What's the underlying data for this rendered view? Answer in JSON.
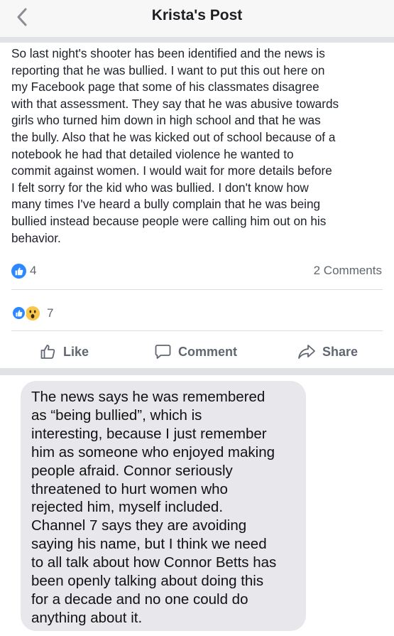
{
  "header": {
    "title": "Krista's Post",
    "back_icon": "chevron-left-icon"
  },
  "post": {
    "text": "So last night's shooter has been identified and the news is\nreporting that he was bullied. I want to put this out here on\nmy Facebook page that some of his classmates disagree\nwith that assessment. They say that he was abusive towards\ngirls who turned him down in high school and that he was\nthe bully. Also that he was kicked out of school because of a\nnotebook he had that detailed violence he wanted to\ncommit against women. I would wait for more details before\nI felt sorry for the kid who was bullied. I don't know how\nmany times I've heard a bully complain that he was being\nbullied instead because people were calling him out on his\nbehavior.",
    "like_count": "4",
    "comments_count": "2 Comments",
    "reaction_count": "7"
  },
  "actions": {
    "like": "Like",
    "comment": "Comment",
    "share": "Share"
  },
  "message": {
    "text": "The news says he was remembered\nas “being bullied”, which is\ninteresting, because I just remember\nhim as someone who enjoyed making\npeople afraid. Connor seriously\nthreatened to hurt women who\nrejected him, myself included.\nChannel 7 says they are avoiding\nsaying his name, but I think we need\nto all talk about how Connor Betts has\nbeen openly talking about doing this\nfor a decade and no one could do\nanything about it."
  },
  "colors": {
    "header_bg": "#f7f7f8",
    "separator": "#e1e2e6",
    "like_blue": "#2d88ff",
    "muted_text": "#606770",
    "bubble_bg": "#e8e8ec"
  }
}
